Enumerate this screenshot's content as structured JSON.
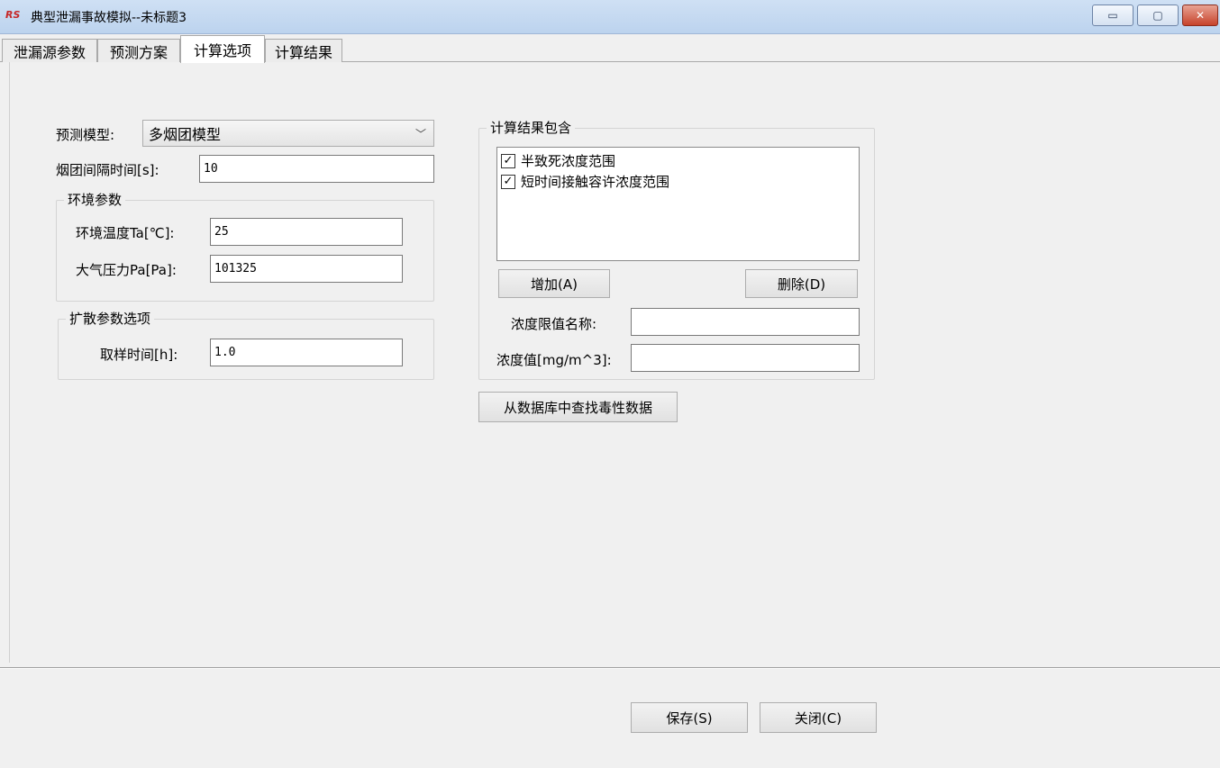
{
  "window": {
    "app_icon": "RS",
    "title": "典型泄漏事故模拟--未标题3",
    "minimize": "▭",
    "maximize": "▢",
    "close": "✕"
  },
  "tabs": [
    "泄漏源参数",
    "预测方案",
    "计算选项",
    "计算结果"
  ],
  "active_tab": "计算选项",
  "left": {
    "model_label": "预测模型:",
    "model_value": "多烟团模型",
    "interval_label": "烟团间隔时间[s]:",
    "interval_value": "10",
    "env_group_title": "环境参数",
    "temp_label": "环境温度Ta[℃]:",
    "temp_value": "25",
    "pressure_label": "大气压力Pa[Pa]:",
    "pressure_value": "101325",
    "diffusion_group_title": "扩散参数选项",
    "sampling_label": "取样时间[h]:",
    "sampling_value": "1.0"
  },
  "right": {
    "results_group_title": "计算结果包含",
    "items": [
      {
        "label": "半致死浓度范围",
        "checked": true
      },
      {
        "label": "短时间接触容许浓度范围",
        "checked": true
      }
    ],
    "add_button": "增加(A)",
    "delete_button": "删除(D)",
    "limit_name_label": "浓度限值名称:",
    "limit_name_value": "",
    "conc_label": "浓度值[mg/m^3]:",
    "conc_value": "",
    "db_button": "从数据库中查找毒性数据"
  },
  "footer": {
    "save_button": "保存(S)",
    "close_button": "关闭(C)"
  }
}
